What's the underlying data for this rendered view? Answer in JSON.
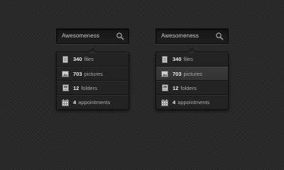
{
  "widgets": [
    {
      "search": {
        "value": "Awesomeness"
      },
      "items": [
        {
          "icon": "file-icon",
          "count": "340",
          "label": "files",
          "hover": false
        },
        {
          "icon": "picture-icon",
          "count": "703",
          "label": "pictures",
          "hover": false
        },
        {
          "icon": "folder-icon",
          "count": "12",
          "label": "folders",
          "hover": false
        },
        {
          "icon": "calendar-icon",
          "count": "4",
          "label": "appointments",
          "hover": false
        }
      ]
    },
    {
      "search": {
        "value": "Awesomeness"
      },
      "items": [
        {
          "icon": "file-icon",
          "count": "340",
          "label": "files",
          "hover": false
        },
        {
          "icon": "picture-icon",
          "count": "703",
          "label": "pictures",
          "hover": true
        },
        {
          "icon": "folder-icon",
          "count": "12",
          "label": "folders",
          "hover": false
        },
        {
          "icon": "calendar-icon",
          "count": "4",
          "label": "appointments",
          "hover": false
        }
      ]
    }
  ],
  "colors": {
    "background": "#2a2a2a",
    "text": "#bdbdbd",
    "hover": "#363636"
  }
}
